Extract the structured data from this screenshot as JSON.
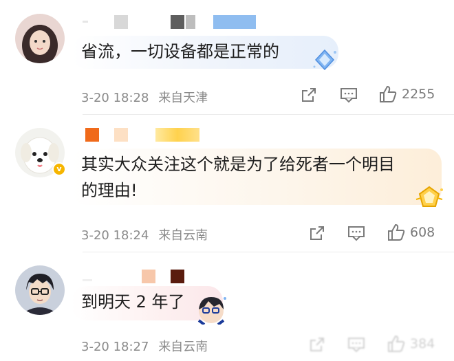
{
  "comments": [
    {
      "text": "省流，一切设备都是正常的",
      "date": "3-20 18:28",
      "location": "来自天津",
      "likes": "2255"
    },
    {
      "text_line1": "其实大众关注这个就是为了给死者一个明目",
      "text_line2": "的理由!",
      "date": "3-20 18:24",
      "location": "来自云南",
      "likes": "608",
      "verified_badge": "v"
    },
    {
      "text": "到明天 2 年了",
      "date": "3-20 18:27",
      "location": "来自云南",
      "likes": "384"
    }
  ],
  "colors": {
    "bubble_blue": "#eef3fb",
    "bubble_peach": "#fdf3e6",
    "bubble_pink": "#fdeeee",
    "meta_gray": "#8a8a8a",
    "verified_gold": "#f6b500"
  },
  "icons": [
    "share-icon",
    "comment-icon",
    "like-icon",
    "diamond-badge-icon",
    "gold-badge-icon",
    "sticker-icon"
  ]
}
